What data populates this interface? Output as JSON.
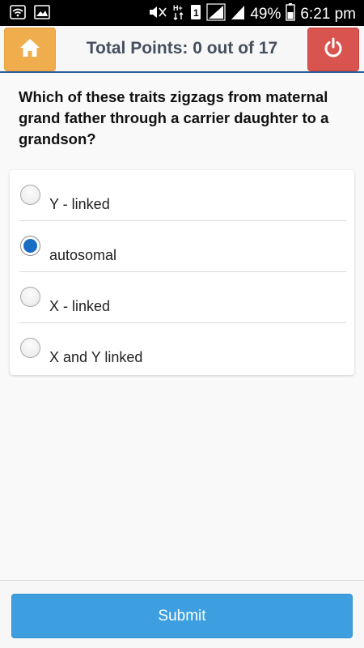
{
  "status_bar": {
    "battery": "49%",
    "time": "6:21 pm",
    "icons": [
      "wifi-icon",
      "image-icon",
      "mute-icon",
      "network-ht-icon",
      "sim-1-icon",
      "signal-icon",
      "signal-2-icon",
      "battery-icon"
    ]
  },
  "header": {
    "points_text": "Total Points: 0 out of 17",
    "home_icon": "home-icon",
    "power_icon": "power-icon",
    "home_color": "#f0ad4e",
    "power_color": "#d9534f"
  },
  "question": {
    "text": "Which of these traits zigzags from maternal grand father through a carrier daughter to  a grandson?"
  },
  "options": [
    {
      "label": "Y - linked",
      "selected": false
    },
    {
      "label": "autosomal",
      "selected": true
    },
    {
      "label": "X - linked",
      "selected": false
    },
    {
      "label": "X and Y linked",
      "selected": false
    }
  ],
  "submit": {
    "label": "Submit",
    "color": "#3d9fe0"
  }
}
